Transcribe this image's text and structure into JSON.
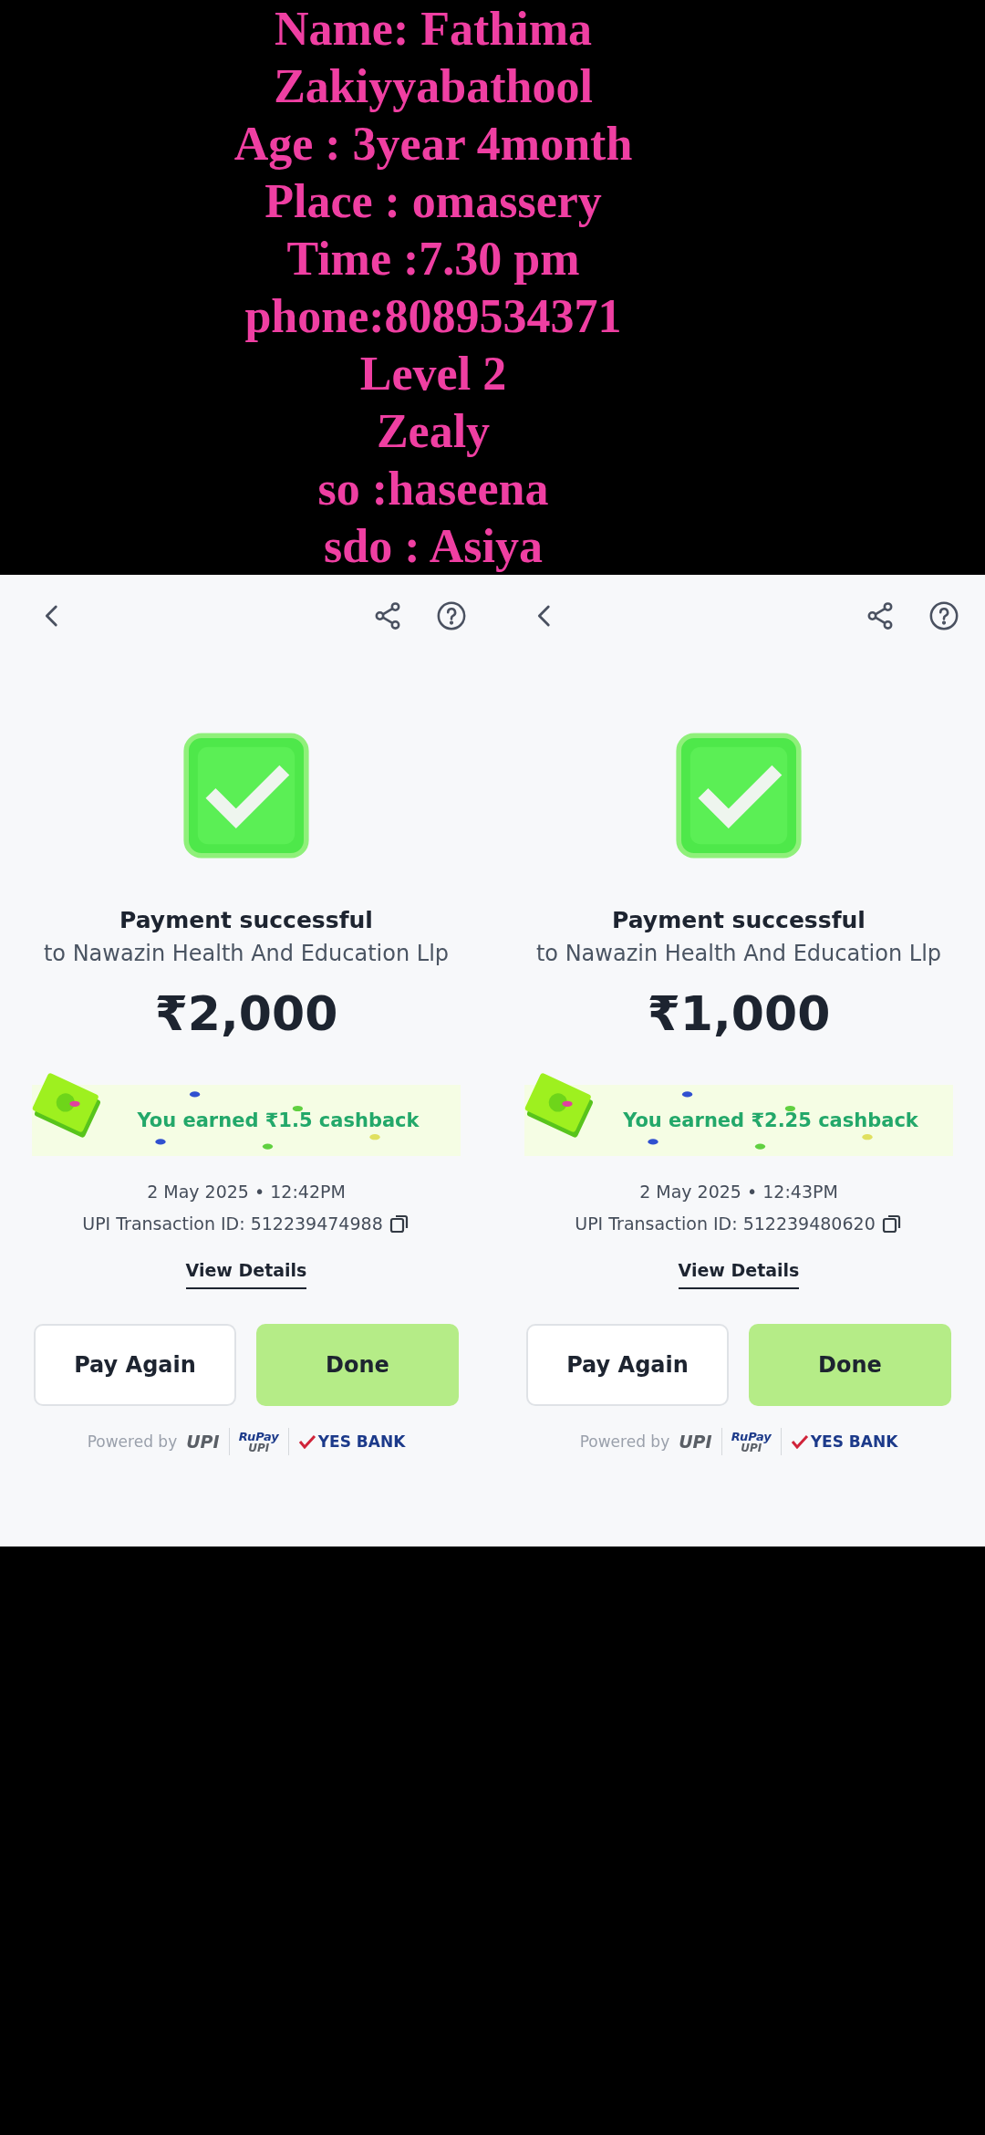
{
  "panels": [
    {
      "title": "Payment successful",
      "recipient": "to Nawazin Health And Education Llp",
      "amount": "₹2,000",
      "cashback": "You earned ₹1.5 cashback",
      "datetime": "2 May 2025 • 12:42PM",
      "transaction_id": "UPI Transaction ID: 512239474988",
      "details_link": "View Details",
      "buttons": [
        "Pay Again",
        "Done"
      ],
      "powered_by": "Powered by",
      "logos": [
        "UPI",
        "RuPay",
        "UPI",
        "YES BANK"
      ]
    },
    {
      "title": "Payment successful",
      "recipient": "to Nawazin Health And Education Llp",
      "amount": "₹1,000",
      "cashback": "You earned ₹2.25 cashback",
      "datetime": "2 May 2025 • 12:43PM",
      "transaction_id": "UPI Transaction ID: 512239480620",
      "details_link": "View Details",
      "buttons": [
        "Pay Again",
        "Done"
      ],
      "powered_by": "Powered by",
      "logos": [
        "UPI",
        "RuPay",
        "UPI",
        "YES BANK"
      ]
    }
  ],
  "overlay_lines": [
    "Name: Fathima",
    "Zakiyyabathool",
    "Age : 3year 4month",
    "Place : omassery",
    "Time :7.30 pm",
    "phone:8089534371",
    "Level 2",
    "Zealy",
    "so :haseena",
    "sdo : Asiya"
  ]
}
